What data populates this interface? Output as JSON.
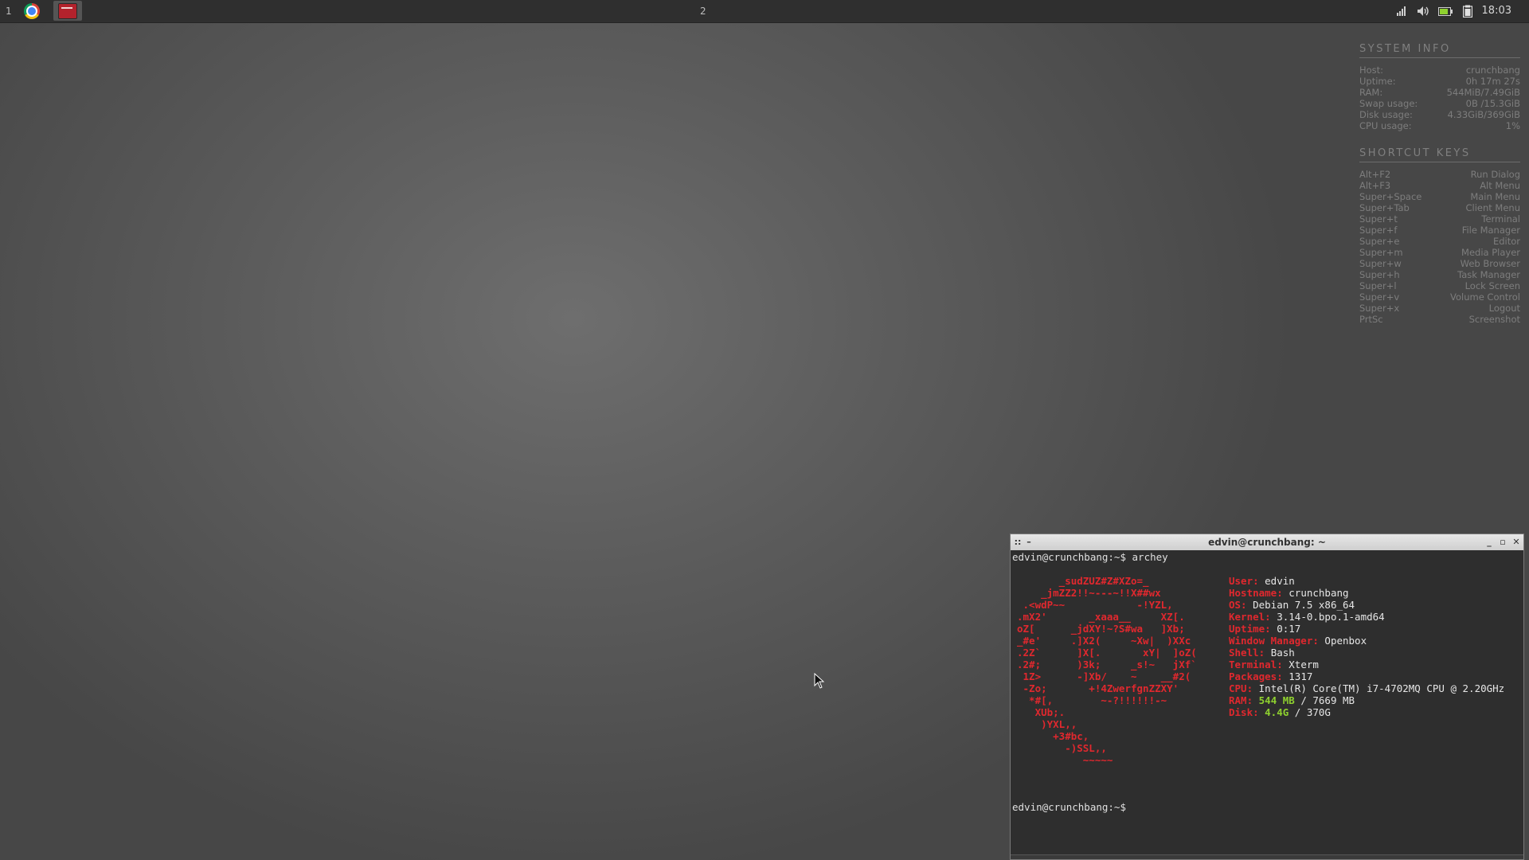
{
  "panel": {
    "workspace_1": "1",
    "workspace_2": "2",
    "clock": "18:03",
    "tray_icons": [
      "network-icon",
      "volume-icon",
      "battery-icon",
      "clipboard-icon"
    ],
    "tasks": [
      "chrome-icon",
      "terminal-icon"
    ]
  },
  "conky": {
    "system_info": {
      "header": "SYSTEM INFO",
      "rows": [
        {
          "label": "Host:",
          "value": "crunchbang"
        },
        {
          "label": "Uptime:",
          "value": "0h 17m 27s"
        },
        {
          "label": "RAM:",
          "value": "544MiB/7.49GiB"
        },
        {
          "label": "Swap usage:",
          "value": "0B /15.3GiB"
        },
        {
          "label": "Disk usage:",
          "value": "4.33GiB/369GiB"
        },
        {
          "label": "CPU usage:",
          "value": "1%"
        }
      ]
    },
    "shortcuts": {
      "header": "SHORTCUT KEYS",
      "rows": [
        {
          "key": "Alt+F2",
          "action": "Run Dialog"
        },
        {
          "key": "Alt+F3",
          "action": "Alt Menu"
        },
        {
          "key": "Super+Space",
          "action": "Main Menu"
        },
        {
          "key": "Super+Tab",
          "action": "Client Menu"
        },
        {
          "key": "Super+t",
          "action": "Terminal"
        },
        {
          "key": "Super+f",
          "action": "File Manager"
        },
        {
          "key": "Super+e",
          "action": "Editor"
        },
        {
          "key": "Super+m",
          "action": "Media Player"
        },
        {
          "key": "Super+w",
          "action": "Web Browser"
        },
        {
          "key": "Super+h",
          "action": "Task Manager"
        },
        {
          "key": "Super+l",
          "action": "Lock Screen"
        },
        {
          "key": "Super+v",
          "action": "Volume Control"
        },
        {
          "key": "Super+x",
          "action": "Logout"
        },
        {
          "key": "PrtSc",
          "action": "Screenshot"
        }
      ]
    }
  },
  "terminal": {
    "title": "edvin@crunchbang: ~",
    "command_line": "edvin@crunchbang:~$ archey",
    "prompt": "edvin@crunchbang:~$",
    "logo": [
      "       _sudZUZ#Z#XZo=_",
      "    _jmZZ2!!~---~!!X##wx",
      " .<wdP~~            -!YZL,",
      ".mX2'       _xaaa__     XZ[.",
      "oZ[      _jdXY!~?S#wa   ]Xb;",
      "_#e'     .]X2(     ~Xw|  )XXc",
      ".2Z`      ]X[.       xY|  ]oZ(",
      ".2#;      )3k;     _s!~   jXf`",
      " 1Z>      -]Xb/    ~    __#2(",
      " -Zo;       +!4ZwerfgnZZXY'",
      "  *#[,        ~-?!!!!!!-~",
      "   XUb;.",
      "    )YXL,,",
      "      +3#bc,",
      "        -)SSL,,",
      "           ~~~~~"
    ],
    "info": [
      {
        "k": "User:",
        "v": "edvin"
      },
      {
        "k": "Hostname:",
        "v": "crunchbang"
      },
      {
        "k": "OS:",
        "v": "Debian 7.5 x86_64"
      },
      {
        "k": "Kernel:",
        "v": "3.14-0.bpo.1-amd64"
      },
      {
        "k": "Uptime:",
        "v": "0:17"
      },
      {
        "k": "Window Manager:",
        "v": "Openbox"
      },
      {
        "k": "Shell:",
        "v": "Bash"
      },
      {
        "k": "Terminal:",
        "v": "Xterm"
      },
      {
        "k": "Packages:",
        "v": "1317"
      },
      {
        "k": "CPU:",
        "v": "Intel(R) Core(TM) i7-4702MQ CPU @ 2.20GHz"
      }
    ],
    "ram": {
      "k": "RAM:",
      "used": "544 MB",
      "rest": " / 7669 MB"
    },
    "disk": {
      "k": "Disk:",
      "used": "4.4G",
      "rest": " / 370G"
    }
  }
}
